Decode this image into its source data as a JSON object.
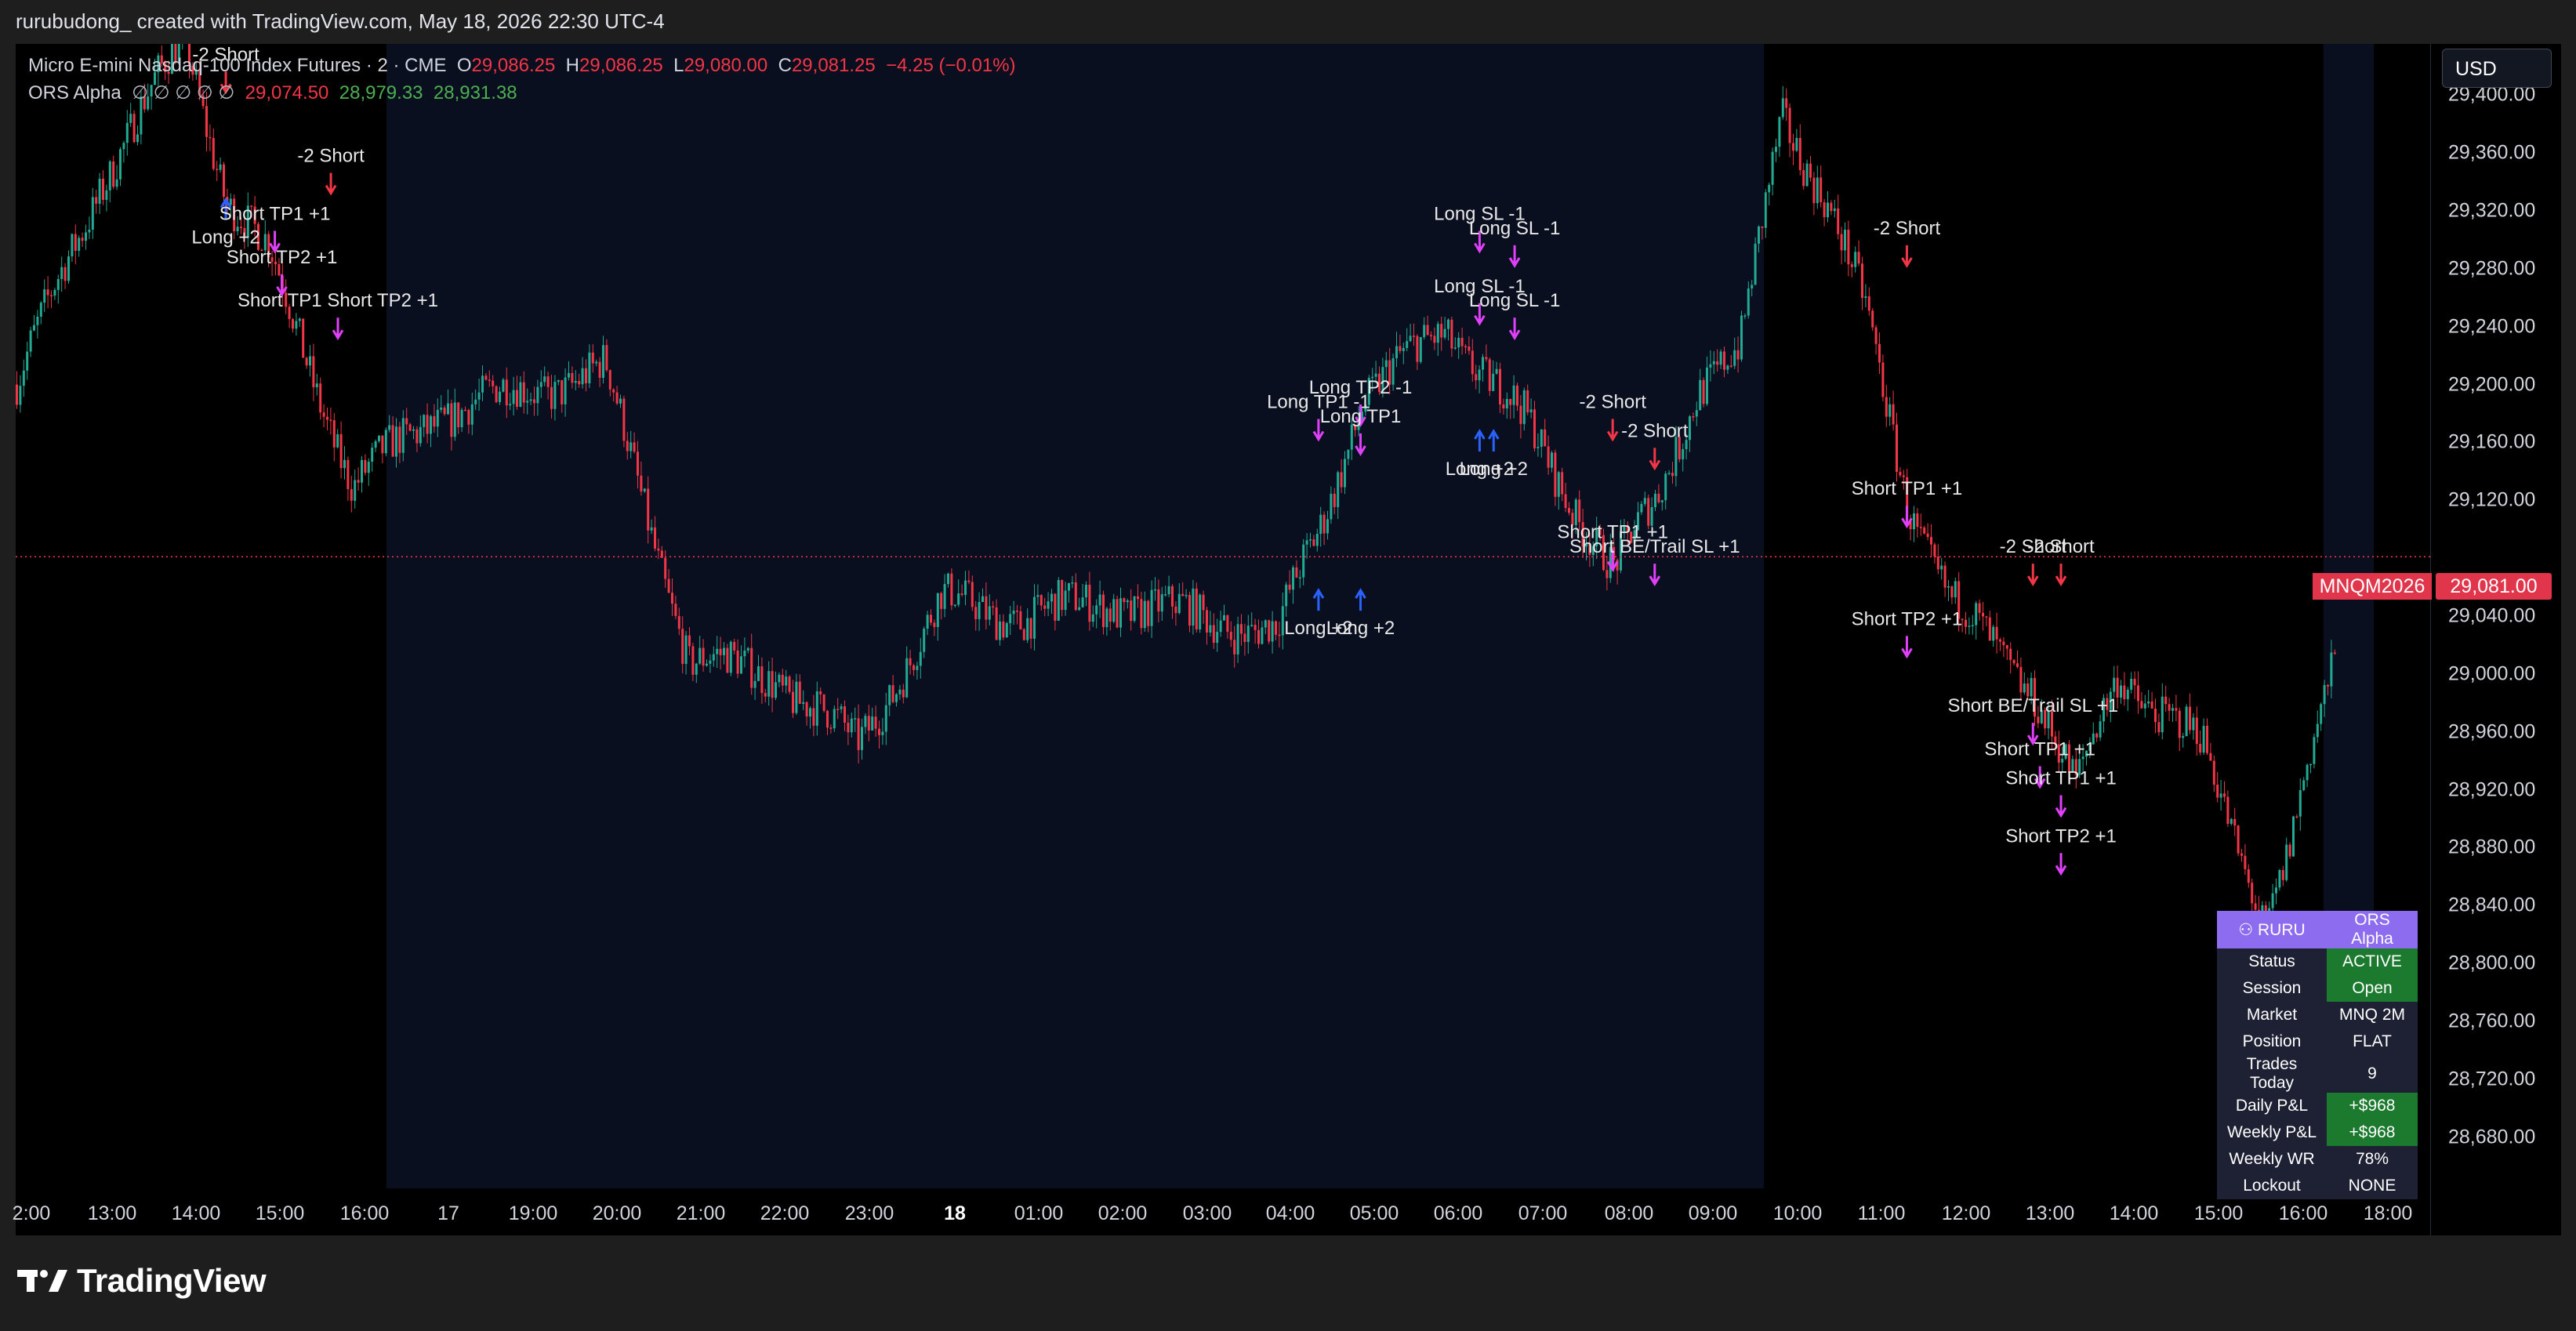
{
  "header": {
    "created_by": "rurubudong_ created with TradingView.com, May 18, 2026 22:30 UTC-4"
  },
  "legend": {
    "symbol": "Micro E-mini Nasdaq-100 Index Futures · 2 · CME",
    "o_label": "O",
    "o_value": "29,086.25",
    "h_label": "H",
    "h_value": "29,086.25",
    "l_label": "L",
    "l_value": "29,080.00",
    "c_label": "C",
    "c_value": "29,081.25",
    "change": "−4.25 (−0.01%)",
    "indicator": "ORS Alpha",
    "indicator_flags": "∅ ∅ ∅ ∅ ∅",
    "ind_v1": "29,074.50",
    "ind_v2": "28,979.33",
    "ind_v3": "28,931.38"
  },
  "currency": "USD",
  "last_price": {
    "value": "29,081.00",
    "symbol": "MNQM2026"
  },
  "price_scale": [
    "29,400.00",
    "29,360.00",
    "29,320.00",
    "29,280.00",
    "29,240.00",
    "29,200.00",
    "29,160.00",
    "29,120.00",
    "29,040.00",
    "29,000.00",
    "28,960.00",
    "28,920.00",
    "28,880.00",
    "28,840.00",
    "28,800.00",
    "28,760.00",
    "28,720.00",
    "28,680.00"
  ],
  "time_axis": [
    {
      "t": "2:00"
    },
    {
      "t": "13:00"
    },
    {
      "t": "14:00"
    },
    {
      "t": "15:00"
    },
    {
      "t": "16:00"
    },
    {
      "t": "17"
    },
    {
      "t": "19:00"
    },
    {
      "t": "20:00"
    },
    {
      "t": "21:00"
    },
    {
      "t": "22:00"
    },
    {
      "t": "23:00"
    },
    {
      "t": "18",
      "bold": true
    },
    {
      "t": "01:00"
    },
    {
      "t": "02:00"
    },
    {
      "t": "03:00"
    },
    {
      "t": "04:00"
    },
    {
      "t": "05:00"
    },
    {
      "t": "06:00"
    },
    {
      "t": "07:00"
    },
    {
      "t": "08:00"
    },
    {
      "t": "09:00"
    },
    {
      "t": "10:00"
    },
    {
      "t": "11:00"
    },
    {
      "t": "12:00"
    },
    {
      "t": "13:00"
    },
    {
      "t": "14:00"
    },
    {
      "t": "15:00"
    },
    {
      "t": "16:00"
    },
    {
      "t": "18:00"
    }
  ],
  "status_panel": {
    "title_left": "RURU",
    "title_right": "ORS Alpha",
    "rows": [
      {
        "k": "Status",
        "v": "ACTIVE",
        "highlight": true
      },
      {
        "k": "Session",
        "v": "Open",
        "highlight": true
      },
      {
        "k": "Market",
        "v": "MNQ 2M",
        "highlight": false
      },
      {
        "k": "Position",
        "v": "FLAT",
        "highlight": false
      },
      {
        "k": "Trades Today",
        "v": "9",
        "highlight": false
      },
      {
        "k": "Daily P&L",
        "v": "+$968",
        "highlight": true
      },
      {
        "k": "Weekly P&L",
        "v": "+$968",
        "highlight": true
      },
      {
        "k": "Weekly WR",
        "v": "78%",
        "highlight": false
      },
      {
        "k": "Lockout",
        "v": "NONE",
        "highlight": false
      }
    ]
  },
  "brand": "TradingView",
  "colors": {
    "up": "#22ab94",
    "down": "#f23645",
    "session_bg": "#0a0f20",
    "signal_long": "#2962ff",
    "signal_short": "#f23645",
    "signal_tp": "#e040fb"
  },
  "chart_data": {
    "type": "candlestick",
    "title": "Micro E-mini Nasdaq-100 Index Futures · 2 · CME",
    "ylim": [
      28650,
      29430
    ],
    "xlabel": "",
    "ylabel": "",
    "last_price": 29081.0,
    "anchors": [
      {
        "t": "12:00",
        "p": 29200
      },
      {
        "t": "13:00",
        "p": 29340
      },
      {
        "t": "14:00",
        "p": 29440
      },
      {
        "t": "14:30",
        "p": 29330
      },
      {
        "t": "15:00",
        "p": 29290
      },
      {
        "t": "16:00",
        "p": 29130
      },
      {
        "t": "17:00",
        "p": 29180
      },
      {
        "t": "19:00",
        "p": 29210
      },
      {
        "t": "20:00",
        "p": 29010
      },
      {
        "t": "21:00",
        "p": 29000
      },
      {
        "t": "22:00",
        "p": 28950
      },
      {
        "t": "23:00",
        "p": 29050
      },
      {
        "t": "00:00",
        "p": 29040
      },
      {
        "t": "01:00",
        "p": 29050
      },
      {
        "t": "02:00",
        "p": 29040
      },
      {
        "t": "03:00",
        "p": 29030
      },
      {
        "t": "03:30",
        "p": 29100
      },
      {
        "t": "04:00",
        "p": 29190
      },
      {
        "t": "05:00",
        "p": 29240
      },
      {
        "t": "06:00",
        "p": 29170
      },
      {
        "t": "07:00",
        "p": 29070
      },
      {
        "t": "07:30",
        "p": 29120
      },
      {
        "t": "08:00",
        "p": 29200
      },
      {
        "t": "08:30",
        "p": 29220
      },
      {
        "t": "09:00",
        "p": 29390
      },
      {
        "t": "09:30",
        "p": 29330
      },
      {
        "t": "10:00",
        "p": 29250
      },
      {
        "t": "10:30",
        "p": 29120
      },
      {
        "t": "11:00",
        "p": 29050
      },
      {
        "t": "12:00",
        "p": 28990
      },
      {
        "t": "12:30",
        "p": 28920
      },
      {
        "t": "13:00",
        "p": 29000
      },
      {
        "t": "14:00",
        "p": 28950
      },
      {
        "t": "14:45",
        "p": 28830
      },
      {
        "t": "15:00",
        "p": 28870
      },
      {
        "t": "15:30",
        "p": 28990
      },
      {
        "t": "16:00",
        "p": 29110
      },
      {
        "t": "16:30",
        "p": 29081
      }
    ],
    "signals": [
      {
        "label": "-2 Short",
        "t": "14:30",
        "p": 29400
      },
      {
        "label": "Long +2",
        "t": "14:30",
        "p": 29330
      },
      {
        "label": "-2 Short",
        "t": "15:45",
        "p": 29330
      },
      {
        "label": "Short TP1 +1",
        "t": "15:05",
        "p": 29290
      },
      {
        "label": "Short TP2 +1",
        "t": "15:10",
        "p": 29260
      },
      {
        "label": "Short TP1 Short TP2 +1",
        "t": "15:50",
        "p": 29230
      },
      {
        "label": "Long TP1 -1",
        "t": "03:30",
        "p": 29160
      },
      {
        "label": "Long TP2 -1",
        "t": "04:00",
        "p": 29170
      },
      {
        "label": "Long TP1",
        "t": "04:00",
        "p": 29150
      },
      {
        "label": "Long +2",
        "t": "03:30",
        "p": 29060
      },
      {
        "label": "Long +2",
        "t": "04:00",
        "p": 29060
      },
      {
        "label": "Long SL -1",
        "t": "05:25",
        "p": 29290
      },
      {
        "label": "Long SL -1",
        "t": "05:50",
        "p": 29280
      },
      {
        "label": "Long SL -1",
        "t": "05:25",
        "p": 29240
      },
      {
        "label": "Long SL -1",
        "t": "05:50",
        "p": 29230
      },
      {
        "label": "Long +2",
        "t": "05:25",
        "p": 29170
      },
      {
        "label": "Long +2",
        "t": "05:35",
        "p": 29170
      },
      {
        "label": "-2 Short",
        "t": "07:00",
        "p": 29160
      },
      {
        "label": "-2 Short",
        "t": "07:30",
        "p": 29140
      },
      {
        "label": "Short TP1 +1",
        "t": "07:00",
        "p": 29070
      },
      {
        "label": "Short BE/Trail SL +1",
        "t": "07:30",
        "p": 29060
      },
      {
        "label": "-2 Short",
        "t": "10:30",
        "p": 29280
      },
      {
        "label": "Short TP1 +1",
        "t": "10:30",
        "p": 29100
      },
      {
        "label": "Short TP2 +1",
        "t": "10:30",
        "p": 29010
      },
      {
        "label": "-2 Short",
        "t": "12:00",
        "p": 29060
      },
      {
        "label": "-2 Short",
        "t": "12:20",
        "p": 29060
      },
      {
        "label": "Short BE/Trail SL +1",
        "t": "12:00",
        "p": 28950
      },
      {
        "label": "Short TP1 +1",
        "t": "12:05",
        "p": 28920
      },
      {
        "label": "Short TP1 +1",
        "t": "12:20",
        "p": 28900
      },
      {
        "label": "Short TP2 +1",
        "t": "12:20",
        "p": 28860
      }
    ]
  }
}
